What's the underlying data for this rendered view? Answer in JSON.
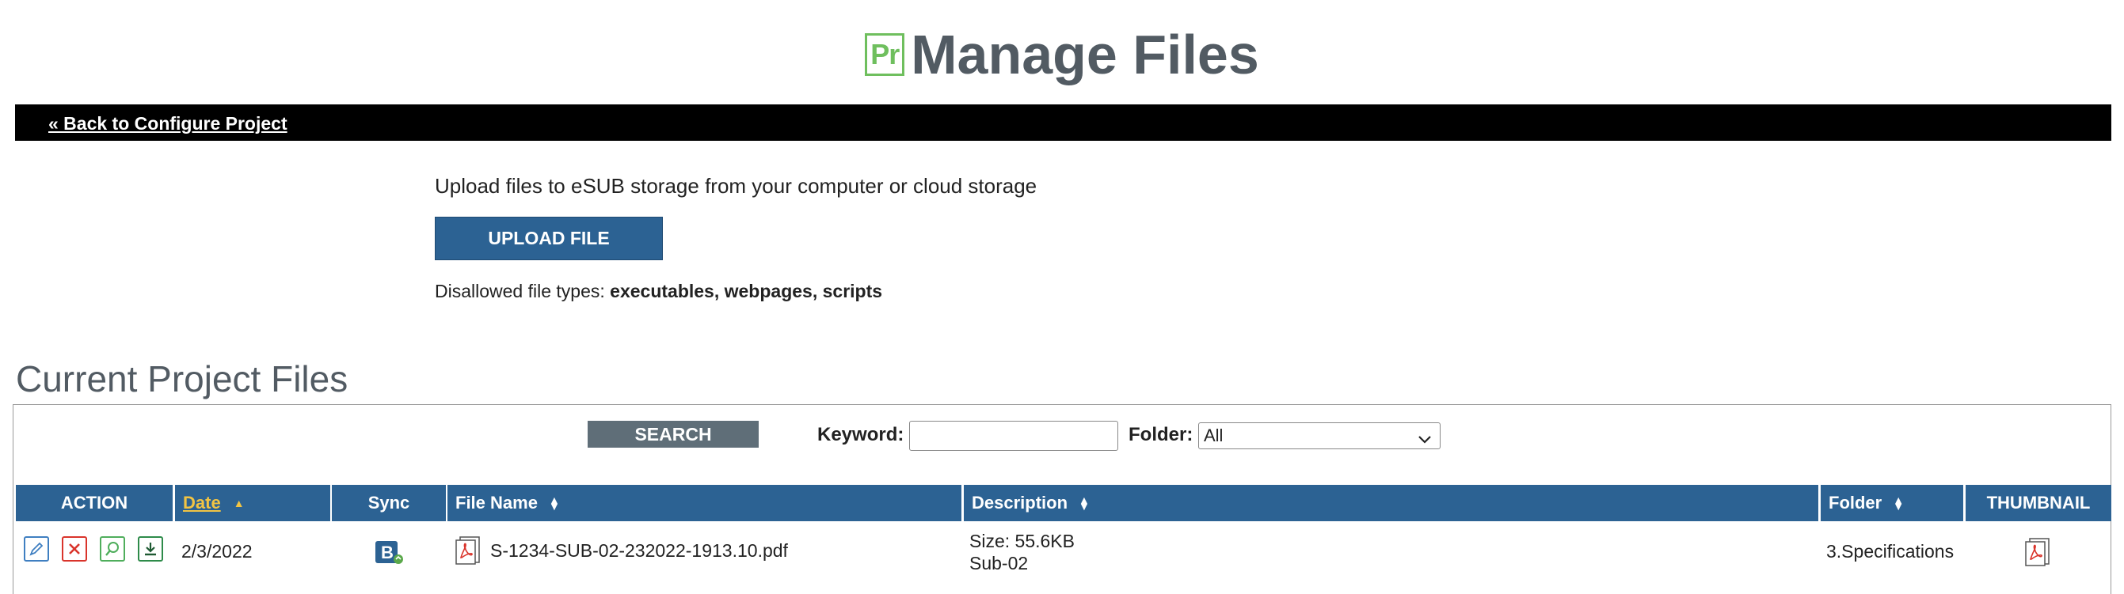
{
  "header": {
    "logo_text": "Pr",
    "title": "Manage Files"
  },
  "nav": {
    "back_link": "« Back to Configure Project"
  },
  "upload": {
    "description": "Upload files to eSUB storage from your computer or cloud storage",
    "button_label": "UPLOAD FILE",
    "disallowed_label": "Disallowed file types:",
    "disallowed_types": "executables, webpages, scripts"
  },
  "files": {
    "section_title": "Current Project Files",
    "search_label": "SEARCH",
    "keyword_label": "Keyword:",
    "keyword_value": "",
    "folder_label": "Folder:",
    "folder_selected": "All",
    "columns": {
      "action": "ACTION",
      "date": "Date",
      "sync": "Sync",
      "file_name": "File Name",
      "description": "Description",
      "folder": "Folder",
      "thumbnail": "THUMBNAIL"
    },
    "rows": [
      {
        "date": "2/3/2022",
        "file_name": "S-1234-SUB-02-232022-1913.10.pdf",
        "size": "Size: 55.6KB",
        "desc2": "Sub-02",
        "folder": "3.Specifications",
        "sync_icon": "box-sync-icon",
        "file_icon": "pdf-file-icon"
      }
    ]
  },
  "colors": {
    "accent_blue": "#2c6293",
    "logo_green": "#6fbf5e",
    "title_gray": "#525b63",
    "sort_active": "#f2c443"
  }
}
